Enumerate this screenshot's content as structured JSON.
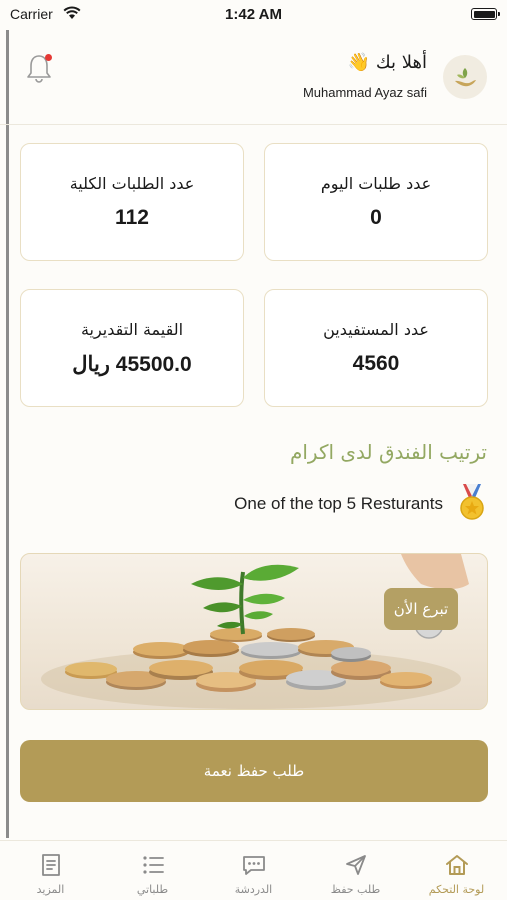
{
  "status_bar": {
    "carrier": "Carrier",
    "time": "1:42 AM"
  },
  "header": {
    "greeting": "أهلا بك 👋",
    "user_name": "Muhammad  Ayaz safi"
  },
  "stats": {
    "today_orders": {
      "label": "عدد طلبات اليوم",
      "value": "0"
    },
    "total_orders": {
      "label": "عدد الطلبات الكلية",
      "value": "112"
    },
    "beneficiaries": {
      "label": "عدد المستفيدين",
      "value": "4560"
    },
    "estimated_value": {
      "label": "القيمة التقديرية",
      "value": "45500.0 ريال"
    }
  },
  "ranking": {
    "title": "ترتيب الفندق لدى اكرام",
    "text": "One of the top 5 Resturants",
    "medal_icon": "medal-icon"
  },
  "banner": {
    "donate_label": "تبرع الأن"
  },
  "main_button": {
    "label": "طلب حفظ نعمة"
  },
  "tabs": [
    {
      "label": "لوحة التحكم",
      "icon": "home-icon",
      "active": true
    },
    {
      "label": "طلب حفظ",
      "icon": "send-icon",
      "active": false
    },
    {
      "label": "الدردشة",
      "icon": "chat-icon",
      "active": false
    },
    {
      "label": "طلباتي",
      "icon": "list-icon",
      "active": false
    },
    {
      "label": "المزيد",
      "icon": "more-icon",
      "active": false
    }
  ],
  "colors": {
    "accent": "#b39b57",
    "ranking_title": "#93a862",
    "card_border": "#e9dfc4",
    "notification_dot": "#e53935"
  }
}
